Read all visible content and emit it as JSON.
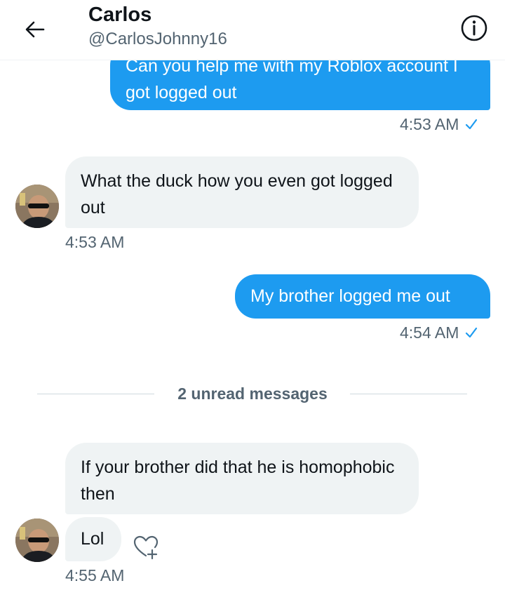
{
  "header": {
    "title": "Carlos",
    "handle": "@CarlosJohnny16",
    "back_icon": "arrow-left-icon",
    "info_icon": "info-icon"
  },
  "messages": [
    {
      "direction": "sent",
      "text": "Can you help me with my Roblox account I got logged out",
      "time": "4:53 AM",
      "read": true
    },
    {
      "direction": "received",
      "text": "What the duck how you even got logged out",
      "time": "4:53 AM"
    },
    {
      "direction": "sent",
      "text": "My brother logged me out",
      "time": "4:54 AM",
      "read": true
    },
    {
      "direction": "received",
      "text": "If your brother did that he is homophobic then"
    },
    {
      "direction": "received",
      "text": "Lol",
      "time": "4:55 AM",
      "reaction_icon": "add-reaction-heart-icon"
    }
  ],
  "divider": {
    "label": "2 unread messages"
  },
  "colors": {
    "accent": "#1d9bf0",
    "received_bubble": "#eff3f4",
    "secondary_text": "#536471"
  }
}
